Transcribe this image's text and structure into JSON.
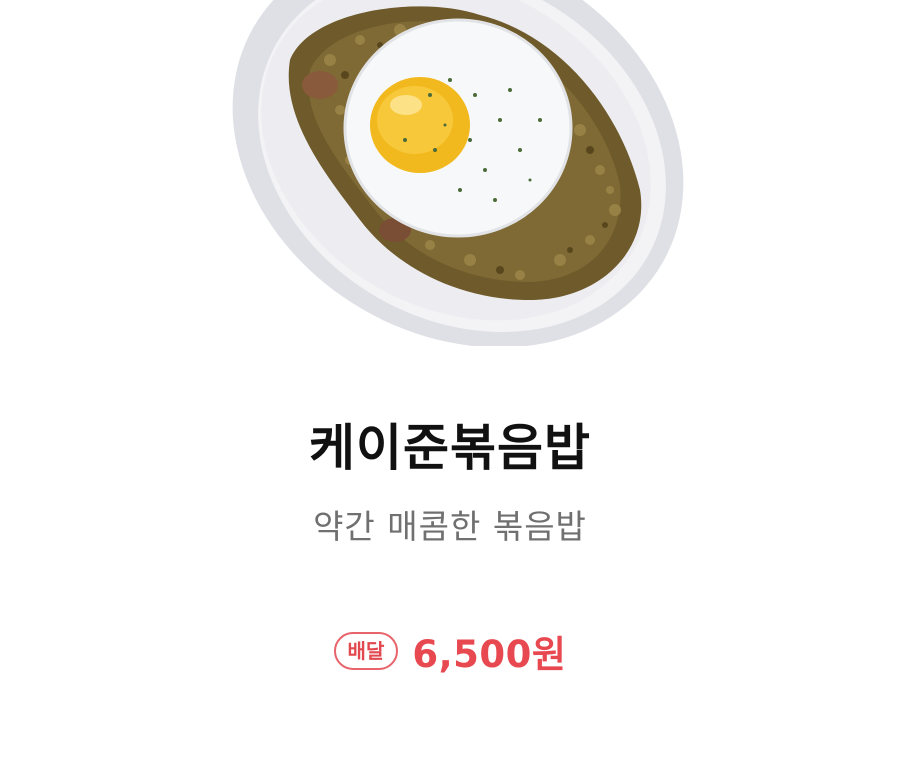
{
  "menu_item": {
    "image_alt": "케이준볶음밥",
    "name": "케이준볶음밥",
    "description": "약간 매콤한 볶음밥",
    "delivery_badge": "배달",
    "price": "6,500원"
  },
  "colors": {
    "accent": "#e84950",
    "title": "#111111",
    "description": "#707070"
  }
}
